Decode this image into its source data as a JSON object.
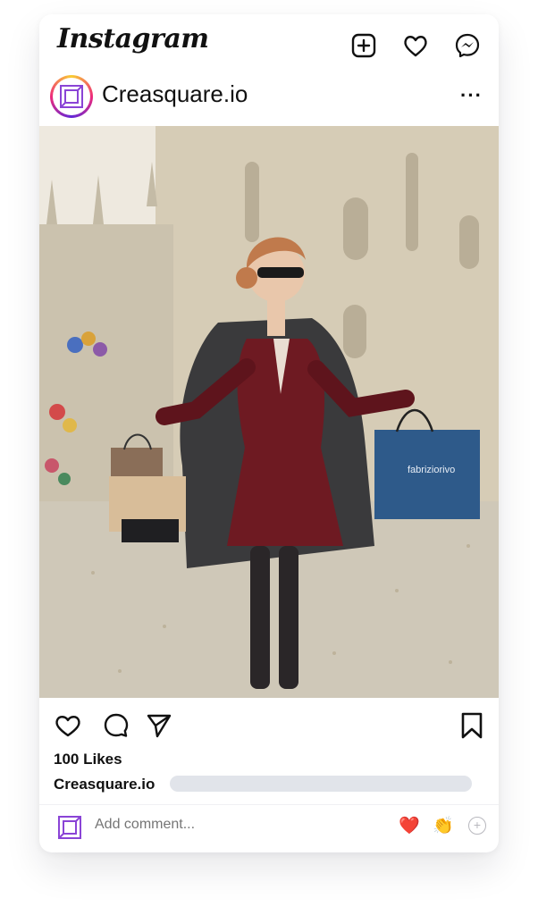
{
  "app": {
    "logo_text": "Instagram"
  },
  "top_icons": [
    "plus-square-icon",
    "heart-icon",
    "messenger-icon"
  ],
  "post": {
    "username": "Creasquare.io",
    "more_label": "···",
    "likes_text": "100 Likes",
    "caption_user": "Creasquare.io",
    "bag_brand": "fabriziorivo"
  },
  "comment": {
    "placeholder": "Add comment...",
    "emoji_heart": "❤️",
    "emoji_clap": "👏",
    "add_label": "+"
  },
  "colors": {
    "text": "#111111",
    "placeholder": "#9b9ba3",
    "bar": "#e1e4ea",
    "accent": "#8a44d6"
  }
}
